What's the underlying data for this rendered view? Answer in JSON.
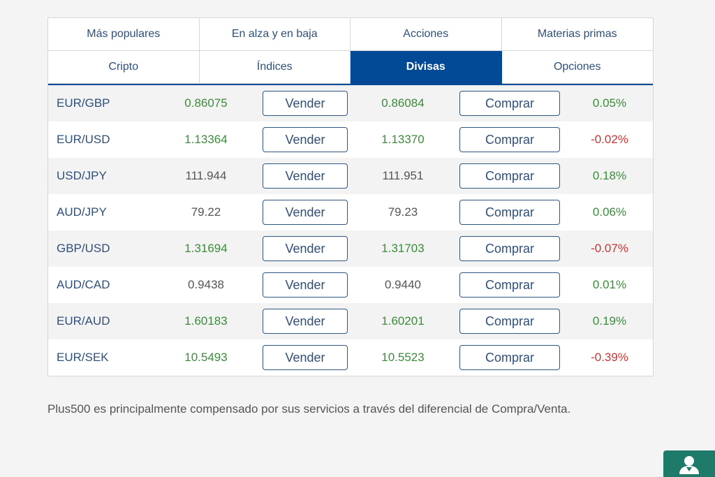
{
  "tabs": [
    {
      "label": "Más populares",
      "active": false
    },
    {
      "label": "En alza y en baja",
      "active": false
    },
    {
      "label": "Acciones",
      "active": false
    },
    {
      "label": "Materias primas",
      "active": false
    },
    {
      "label": "Cripto",
      "active": false
    },
    {
      "label": "Índices",
      "active": false
    },
    {
      "label": "Divisas",
      "active": true
    },
    {
      "label": "Opciones",
      "active": false
    }
  ],
  "buttons": {
    "sell_label": "Vender",
    "buy_label": "Comprar"
  },
  "rows": [
    {
      "symbol": "EUR/GBP",
      "sell": "0.86075",
      "buy": "0.86084",
      "change": "0.05%",
      "price_trend": "up",
      "change_dir": "pos"
    },
    {
      "symbol": "EUR/USD",
      "sell": "1.13364",
      "buy": "1.13370",
      "change": "-0.02%",
      "price_trend": "up",
      "change_dir": "neg"
    },
    {
      "symbol": "USD/JPY",
      "sell": "111.944",
      "buy": "111.951",
      "change": "0.18%",
      "price_trend": "neutral",
      "change_dir": "pos"
    },
    {
      "symbol": "AUD/JPY",
      "sell": "79.22",
      "buy": "79.23",
      "change": "0.06%",
      "price_trend": "neutral",
      "change_dir": "pos"
    },
    {
      "symbol": "GBP/USD",
      "sell": "1.31694",
      "buy": "1.31703",
      "change": "-0.07%",
      "price_trend": "up",
      "change_dir": "neg"
    },
    {
      "symbol": "AUD/CAD",
      "sell": "0.9438",
      "buy": "0.9440",
      "change": "0.01%",
      "price_trend": "neutral",
      "change_dir": "pos"
    },
    {
      "symbol": "EUR/AUD",
      "sell": "1.60183",
      "buy": "1.60201",
      "change": "0.19%",
      "price_trend": "up",
      "change_dir": "pos"
    },
    {
      "symbol": "EUR/SEK",
      "sell": "10.5493",
      "buy": "10.5523",
      "change": "-0.39%",
      "price_trend": "up",
      "change_dir": "neg"
    }
  ],
  "footnote": "Plus500 es principalmente compensado por sus servicios a través del diferencial de Compra/Venta.",
  "colors": {
    "accent": "#034a96",
    "positive": "#3b8b3b",
    "negative": "#cc3333",
    "help_button": "#1e7b6a"
  },
  "icons": {
    "help": "user-support-icon"
  }
}
